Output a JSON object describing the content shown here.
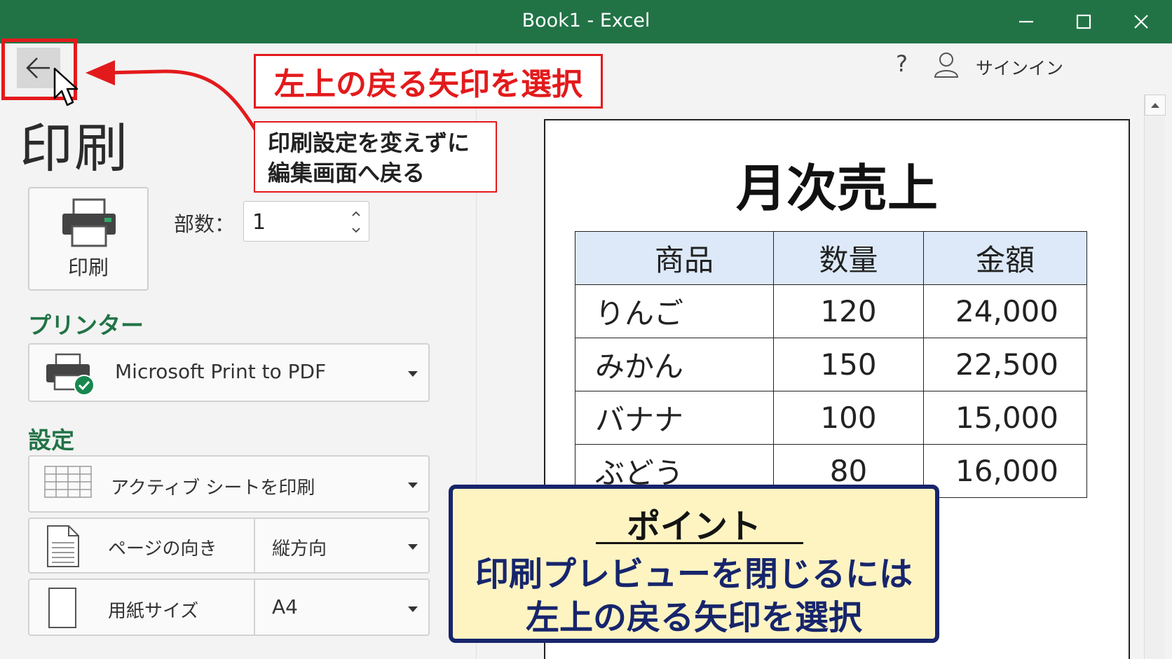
{
  "window": {
    "title": "Book1  -  Excel"
  },
  "header": {
    "help_icon": "?",
    "signin_label": "サインイン"
  },
  "backstage": {
    "page_title": "印刷",
    "print_button_label": "印刷",
    "copies_label": "部数：",
    "copies_value": "1",
    "printer_heading": "プリンター",
    "printer_name": "Microsoft Print to PDF",
    "settings_heading": "設定",
    "settings": {
      "print_what": "アクティブ シートを印刷",
      "orientation_label": "ページの向き",
      "orientation_value": "縦方向",
      "paper_label": "用紙サイズ",
      "paper_value": "A4"
    }
  },
  "preview": {
    "title": "月次売上",
    "columns": [
      "商品",
      "数量",
      "金額"
    ],
    "rows": [
      [
        "りんご",
        "120",
        "24,000"
      ],
      [
        "みかん",
        "150",
        "22,500"
      ],
      [
        "バナナ",
        "100",
        "15,000"
      ],
      [
        "ぶどう",
        "80",
        "16,000"
      ]
    ]
  },
  "annotations": {
    "main_callout": "左上の戻る矢印を選択",
    "sub_callout_line1": "印刷設定を変えずに",
    "sub_callout_line2": "編集画面へ戻る",
    "point_heading": "ポイント",
    "point_line1": "印刷プレビューを閉じるには",
    "point_line2": "左上の戻る矢印を選択"
  },
  "colors": {
    "excel_green": "#217346",
    "annotation_red": "#e31a1c",
    "point_navy": "#17256c",
    "point_bg": "#fdf4c2",
    "table_header_bg": "#dde9f8"
  }
}
